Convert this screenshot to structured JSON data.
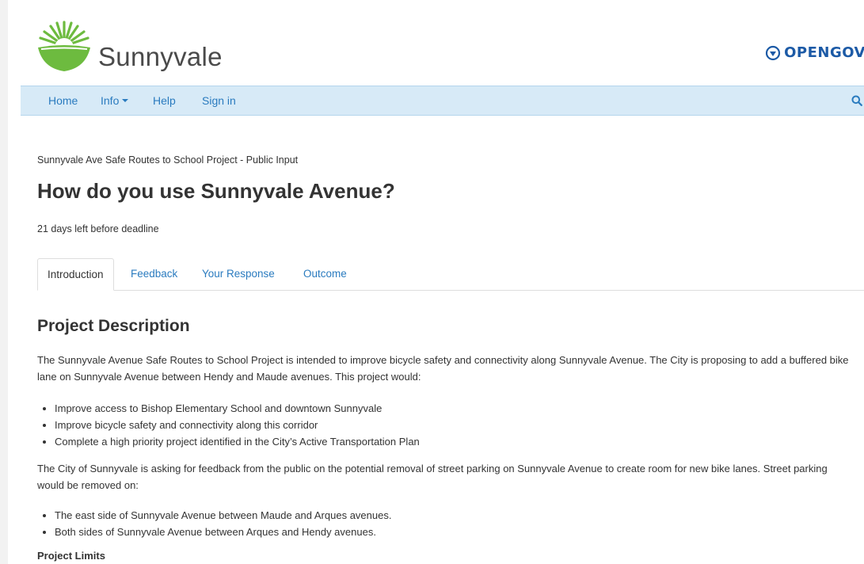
{
  "brand": {
    "name": "Sunnyvale",
    "partner": "OPENGOV"
  },
  "nav": {
    "items": [
      "Home",
      "Info",
      "Help",
      "Sign in"
    ],
    "search_icon": "search-icon"
  },
  "breadcrumb": "Sunnyvale Ave Safe Routes to School Project - Public Input",
  "title": "How do you use Sunnyvale Avenue?",
  "deadline": "21 days left before deadline",
  "tabs": [
    {
      "label": "Introduction",
      "active": true
    },
    {
      "label": "Feedback",
      "active": false
    },
    {
      "label": "Your Response",
      "active": false
    },
    {
      "label": "Outcome",
      "active": false
    }
  ],
  "content": {
    "heading": "Project Description",
    "para1": "The Sunnyvale Avenue Safe Routes to School Project is intended to improve bicycle safety and connectivity along Sunnyvale Avenue. The City is proposing to add a buffered bike lane on Sunnyvale Avenue between Hendy and Maude avenues. This project would:",
    "bullets1": [
      "Improve access to Bishop Elementary School and downtown Sunnyvale",
      "Improve bicycle safety and connectivity along this corridor",
      "Complete a high priority project identified in the City’s Active Transportation Plan"
    ],
    "para2": "The City of Sunnyvale is asking for feedback from the public on the potential removal of street parking on Sunnyvale Avenue to create room for new bike lanes. Street parking would be removed on:",
    "bullets2": [
      "The east side of Sunnyvale Avenue between Maude and Arques avenues.",
      "Both sides of Sunnyvale Avenue between Arques and Hendy avenues."
    ],
    "subheading": "Project Limits"
  },
  "colors": {
    "link": "#2a7bbf",
    "navbar_bg": "#d7eaf7",
    "logo_green": "#6dbb3f",
    "opengov_blue": "#1c5aa6"
  }
}
